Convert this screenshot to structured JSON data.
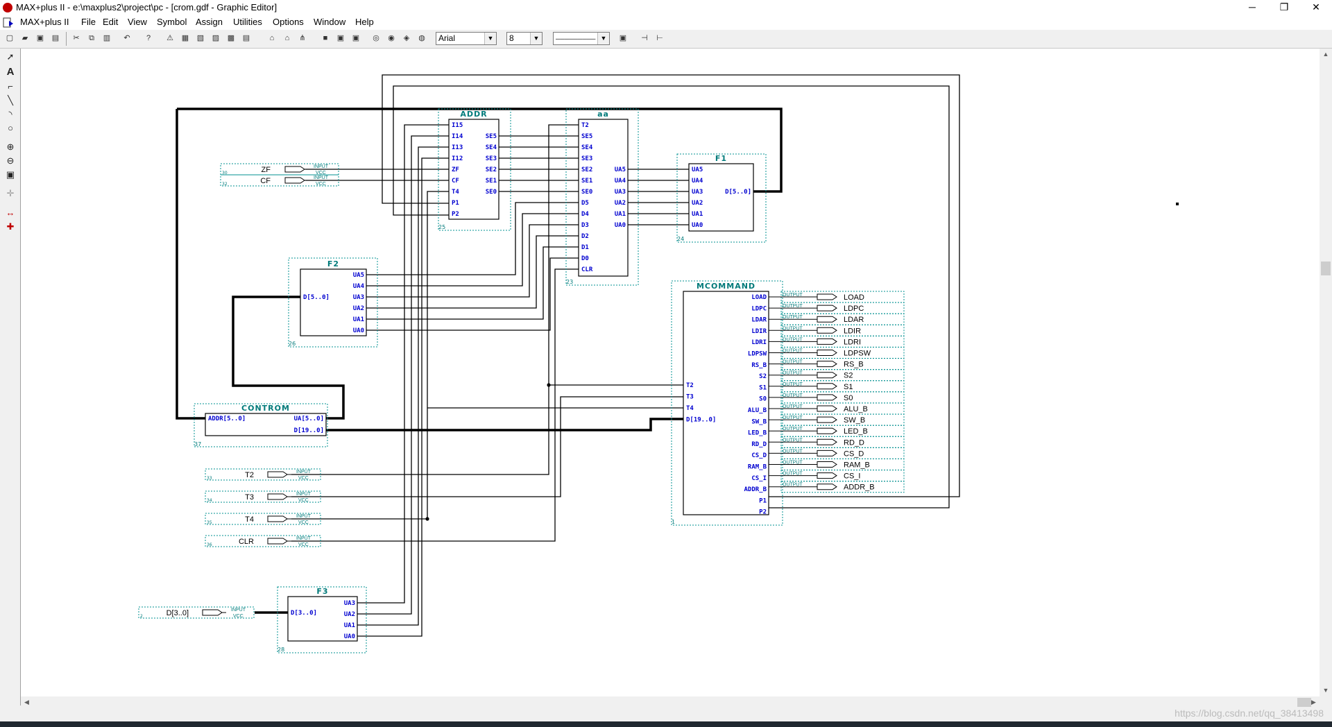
{
  "window": {
    "title": "MAX+plus II - e:\\maxplus2\\project\\pc - [crom.gdf - Graphic Editor]",
    "minimize_glyph": "─",
    "restore_glyph": "❐",
    "close_glyph": "✕"
  },
  "menu": [
    "MAX+plus II",
    "File",
    "Edit",
    "View",
    "Symbol",
    "Assign",
    "Utilities",
    "Options",
    "Window",
    "Help"
  ],
  "toolbar": {
    "font_name": "Arial",
    "font_size": "8",
    "line_style": "─────────"
  },
  "colors": {
    "wire": "#000000",
    "block_border": "#000000",
    "port_text": "#0000d0",
    "block_title": "#007a7a"
  },
  "blocks": [
    {
      "id": "addr",
      "title": "ADDR",
      "number": "25",
      "inputs": [
        "I15",
        "I14",
        "I13",
        "I12",
        "ZF",
        "CF",
        "T4",
        "P1",
        "P2"
      ],
      "outputs": [
        "SE5",
        "SE4",
        "SE3",
        "SE2",
        "SE1",
        "SE0"
      ]
    },
    {
      "id": "aa",
      "title": "aa",
      "number": "23",
      "inputs": [
        "T2",
        "SE5",
        "SE4",
        "SE3",
        "SE2",
        "SE1",
        "SE0",
        "D5",
        "D4",
        "D3",
        "D2",
        "D1",
        "D0",
        "CLR"
      ],
      "outputs": [
        "UA5",
        "UA4",
        "UA3",
        "UA2",
        "UA1",
        "UA0"
      ]
    },
    {
      "id": "f1",
      "title": "F1",
      "number": "24",
      "inputs": [
        "UA5",
        "UA4",
        "UA3",
        "UA2",
        "UA1",
        "UA0"
      ],
      "outputs": [
        "D[5..0]"
      ]
    },
    {
      "id": "f2",
      "title": "F2",
      "number": "26",
      "inputs": [
        "D[5..0]"
      ],
      "outputs": [
        "UA5",
        "UA4",
        "UA3",
        "UA2",
        "UA1",
        "UA0"
      ]
    },
    {
      "id": "contrLabel",
      "title": "CONTROM",
      "number": "37",
      "inputs": [
        "ADDR[5..0]"
      ],
      "outputs": [
        "UA[5..0]",
        "D[19..0]"
      ]
    },
    {
      "id": "mcommand",
      "title": "MCOMMAND",
      "number": "1",
      "inputs": [
        "T2",
        "T3",
        "T4",
        "D[19..0]"
      ],
      "outputs": [
        "LOAD",
        "LDPC",
        "LDAR",
        "LDIR",
        "LDRI",
        "LDPSW",
        "RS_B",
        "S2",
        "S1",
        "S0",
        "ALU_B",
        "SW_B",
        "LED_B",
        "RD_D",
        "CS_D",
        "RAM_B",
        "CS_I",
        "ADDR_B",
        "P1",
        "P2"
      ]
    },
    {
      "id": "f3",
      "title": "F3",
      "number": "28",
      "inputs": [
        "D[3..0]"
      ],
      "outputs": [
        "UA3",
        "UA2",
        "UA1",
        "UA0"
      ]
    }
  ],
  "input_pins": [
    {
      "name": "ZF",
      "type": "INPUT",
      "vcc": "VCC",
      "number": "30"
    },
    {
      "name": "CF",
      "type": "INPUT",
      "vcc": "VCC",
      "number": "32"
    },
    {
      "name": "T2",
      "type": "INPUT",
      "vcc": "VCC",
      "number": "33"
    },
    {
      "name": "T3",
      "type": "INPUT",
      "vcc": "VCC",
      "number": "34"
    },
    {
      "name": "T4",
      "type": "INPUT",
      "vcc": "VCC",
      "number": "35"
    },
    {
      "name": "CLR",
      "type": "INPUT",
      "vcc": "VCC",
      "number": "36"
    },
    {
      "name": "D[3..0]",
      "type": "INPUT",
      "vcc": "VCC",
      "number": "2"
    }
  ],
  "output_pins": [
    {
      "name": "LOAD",
      "type": "OUTPUT"
    },
    {
      "name": "LDPC",
      "type": "OUTPUT"
    },
    {
      "name": "LDAR",
      "type": "OUTPUT"
    },
    {
      "name": "LDIR",
      "type": "OUTPUT"
    },
    {
      "name": "LDRI",
      "type": "OUTPUT"
    },
    {
      "name": "LDPSW",
      "type": "OUTPUT"
    },
    {
      "name": "RS_B",
      "type": "OUTPUT"
    },
    {
      "name": "S2",
      "type": "OUTPUT"
    },
    {
      "name": "S1",
      "type": "OUTPUT"
    },
    {
      "name": "S0",
      "type": "OUTPUT"
    },
    {
      "name": "ALU_B",
      "type": "OUTPUT"
    },
    {
      "name": "SW_B",
      "type": "OUTPUT"
    },
    {
      "name": "LED_B",
      "type": "OUTPUT"
    },
    {
      "name": "RD_D",
      "type": "OUTPUT"
    },
    {
      "name": "CS_D",
      "type": "OUTPUT"
    },
    {
      "name": "RAM_B",
      "type": "OUTPUT"
    },
    {
      "name": "CS_I",
      "type": "OUTPUT"
    },
    {
      "name": "ADDR_B",
      "type": "OUTPUT"
    }
  ],
  "watermark": "https://blog.csdn.net/qq_38413498"
}
